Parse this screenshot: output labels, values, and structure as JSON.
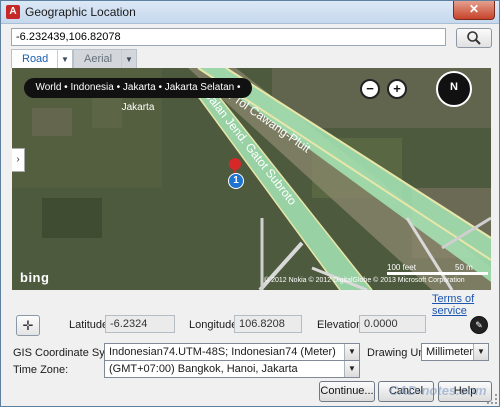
{
  "window": {
    "title": "Geographic Location",
    "close_label": "✕"
  },
  "search": {
    "value": "-6.232439,106.82078",
    "button_icon": "search-icon"
  },
  "map_tabs": [
    {
      "label": "Road",
      "selected": true
    },
    {
      "label": "Aerial",
      "selected": false
    }
  ],
  "map": {
    "breadcrumb": "World • Indonesia • Jakarta • Jakarta Selatan • Jakarta",
    "zoom_out": "−",
    "zoom_in": "+",
    "compass_label": "N",
    "road_labels": [
      "Jalan Tol Cawang-Pluit",
      "Jalan Jend. Gatot Subroto"
    ],
    "pin_label": "1",
    "logo": "bing",
    "scale_top": "100 feet",
    "scale_right": "50 m",
    "copyright": "© 2012 Nokia   © 2012 DigitalGlobe   © 2013 Microsoft Corporation"
  },
  "terms_link": "Terms of service",
  "coordinates": {
    "latitude_label": "Latitude:",
    "latitude_value": "-6.2324",
    "longitude_label": "Longitude:",
    "longitude_value": "106.8208",
    "elevation_label": "Elevation:",
    "elevation_value": "0.0000"
  },
  "gis": {
    "label": "GIS Coordinate System:",
    "value": "Indonesian74.UTM-48S; Indonesian74 (Meter)"
  },
  "drawing_unit": {
    "label": "Drawing Unit:",
    "value": "Millimeters"
  },
  "time_zone": {
    "label": "Time Zone:",
    "value": "(GMT+07:00) Bangkok, Hanoi, Jakarta"
  },
  "buttons": {
    "continue": "Continue...",
    "cancel": "Cancel",
    "help": "Help"
  },
  "watermark": "CAD-notes.com",
  "colors": {
    "road_green": "#a6e6b6",
    "highway_outline": "#e8e6a8",
    "link_blue": "#1c56b0",
    "pin_red": "#d62828",
    "pin_blue": "#1f73d1"
  }
}
